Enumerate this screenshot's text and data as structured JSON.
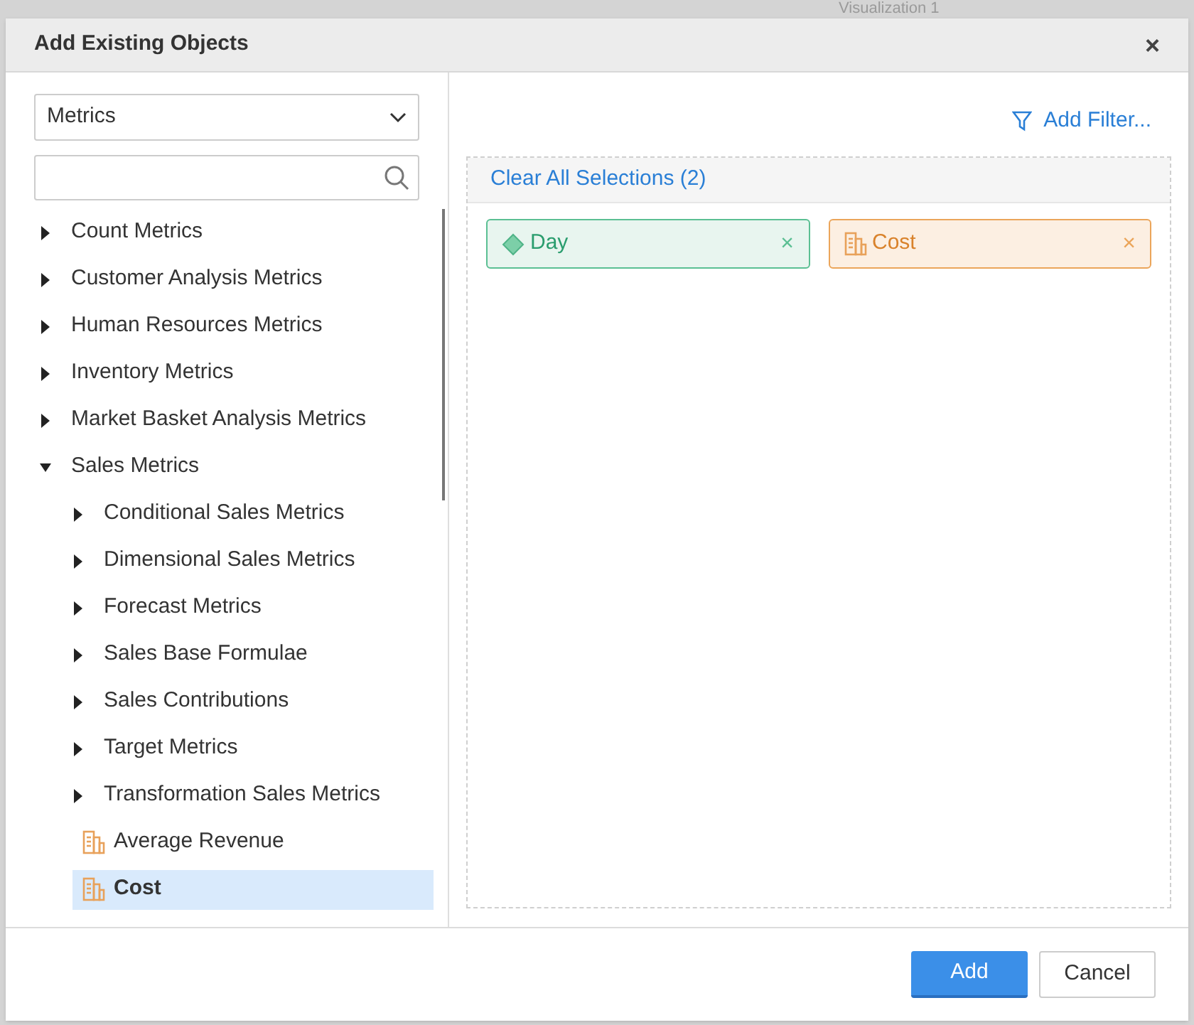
{
  "background": {
    "title": "Visualization 1"
  },
  "dialog": {
    "title": "Add Existing Objects",
    "close": "×"
  },
  "left": {
    "dropdown": {
      "value": "Metrics"
    },
    "tree": [
      {
        "kind": "folder",
        "label": "Count Metrics",
        "expanded": false,
        "selected": false
      },
      {
        "kind": "folder",
        "label": "Customer Analysis Metrics",
        "expanded": false,
        "selected": false
      },
      {
        "kind": "folder",
        "label": "Human Resources Metrics",
        "expanded": false,
        "selected": false
      },
      {
        "kind": "folder",
        "label": "Inventory Metrics",
        "expanded": false,
        "selected": false
      },
      {
        "kind": "folder",
        "label": "Market Basket Analysis Metrics",
        "expanded": false,
        "selected": false
      },
      {
        "kind": "folder",
        "label": "Sales Metrics",
        "expanded": true,
        "selected": false,
        "children": [
          {
            "kind": "folder",
            "label": "Conditional Sales Metrics",
            "expanded": false,
            "selected": false
          },
          {
            "kind": "folder",
            "label": "Dimensional Sales Metrics",
            "expanded": false,
            "selected": false
          },
          {
            "kind": "folder",
            "label": "Forecast Metrics",
            "expanded": false,
            "selected": false
          },
          {
            "kind": "folder",
            "label": "Sales Base Formulae",
            "expanded": false,
            "selected": false
          },
          {
            "kind": "folder",
            "label": "Sales Contributions",
            "expanded": false,
            "selected": false
          },
          {
            "kind": "folder",
            "label": "Target Metrics",
            "expanded": false,
            "selected": false
          },
          {
            "kind": "folder",
            "label": "Transformation Sales Metrics",
            "expanded": false,
            "selected": false
          },
          {
            "kind": "metric",
            "label": "Average Revenue",
            "selected": false
          },
          {
            "kind": "metric",
            "label": "Cost",
            "selected": true
          }
        ]
      }
    ]
  },
  "right": {
    "add_filter": "Add Filter...",
    "clear_all": "Clear All Selections (2)",
    "selections": [
      {
        "kind": "attribute",
        "label": "Day",
        "remove": "×"
      },
      {
        "kind": "metric",
        "label": "Cost",
        "remove": "×"
      }
    ]
  },
  "buttons": [
    {
      "kind": "primary",
      "label": "Add"
    },
    {
      "kind": "secondary",
      "label": "Cancel"
    }
  ]
}
